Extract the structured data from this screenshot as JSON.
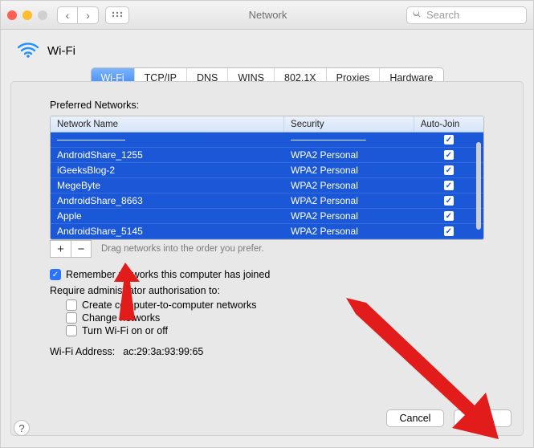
{
  "window_title": "Network",
  "search": {
    "placeholder": "Search"
  },
  "header": {
    "title": "Wi-Fi"
  },
  "tabs": [
    "Wi-Fi",
    "TCP/IP",
    "DNS",
    "WINS",
    "802.1X",
    "Proxies",
    "Hardware"
  ],
  "selected_tab": 0,
  "section_label": "Preferred Networks:",
  "columns": {
    "name": "Network Name",
    "security": "Security",
    "auto": "Auto-Join"
  },
  "networks": [
    {
      "name": "──────────",
      "security": "───────────",
      "auto_join": true
    },
    {
      "name": "AndroidShare_1255",
      "security": "WPA2 Personal",
      "auto_join": true
    },
    {
      "name": "iGeeksBlog-2",
      "security": "WPA2 Personal",
      "auto_join": true
    },
    {
      "name": "MegeByte",
      "security": "WPA2 Personal",
      "auto_join": true
    },
    {
      "name": "AndroidShare_8663",
      "security": "WPA2 Personal",
      "auto_join": true
    },
    {
      "name": "Apple",
      "security": "WPA2 Personal",
      "auto_join": true
    },
    {
      "name": "AndroidShare_5145",
      "security": "WPA2 Personal",
      "auto_join": true
    }
  ],
  "hint": "Drag networks into the order you prefer.",
  "remember": {
    "label": "Remember networks this computer has joined",
    "checked": true
  },
  "auth_label": "Require administrator authorisation to:",
  "auth_opts": [
    {
      "label": "Create computer-to-computer networks",
      "checked": false
    },
    {
      "label": "Change networks",
      "checked": false
    },
    {
      "label": "Turn Wi-Fi on or off",
      "checked": false
    }
  ],
  "addr": {
    "label": "Wi-Fi Address:",
    "value": "ac:29:3a:93:99:65"
  },
  "buttons": {
    "cancel": "Cancel",
    "ok": "OK"
  },
  "glyphs": {
    "check": "✓",
    "chev_left": "‹",
    "chev_right": "›",
    "plus": "+",
    "minus": "−",
    "help": "?"
  }
}
